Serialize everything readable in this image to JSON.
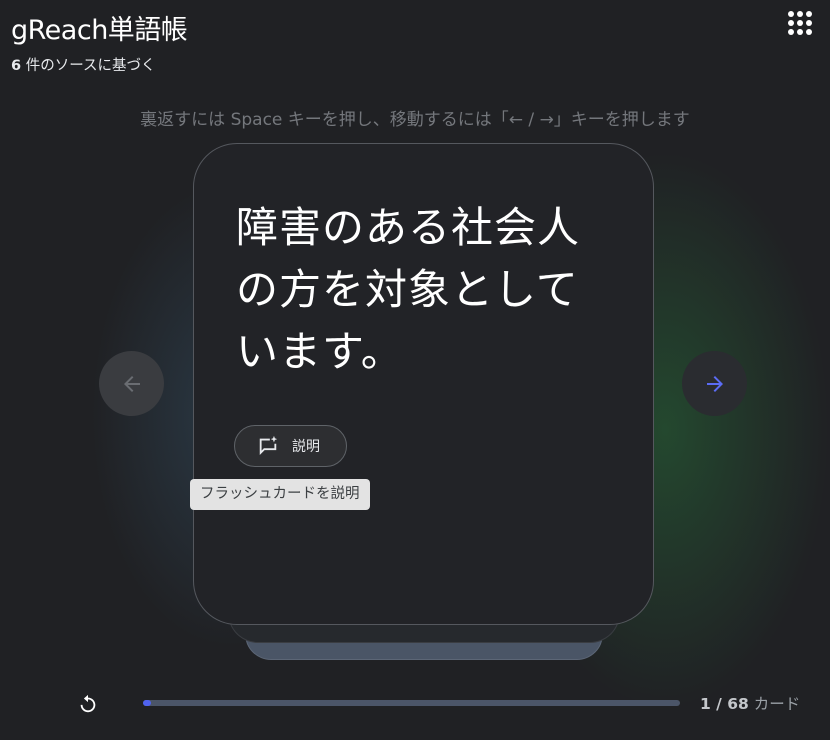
{
  "header": {
    "title": "gReach単語帳",
    "source_count": "6",
    "source_suffix": "件のソースに基づく",
    "apps_icon": "apps-grid-icon"
  },
  "hint": "裏返すには Space キーを押し、移動するには「← / →」キーを押します",
  "card": {
    "front_text": "障害のある社会人の方を対象としています。",
    "explain_label": "説明",
    "explain_icon": "sparkle-comment-icon",
    "tooltip": "フラッシュカードを説明"
  },
  "nav": {
    "prev_icon": "arrow-left-icon",
    "next_icon": "arrow-right-icon"
  },
  "footer": {
    "reset_icon": "reset-icon",
    "progress_current": 1,
    "progress_total": 68,
    "counter_value": "1 / 68",
    "counter_unit": "カード"
  },
  "colors": {
    "background": "#202124",
    "accent": "#4f62ef",
    "card": "#222327"
  }
}
